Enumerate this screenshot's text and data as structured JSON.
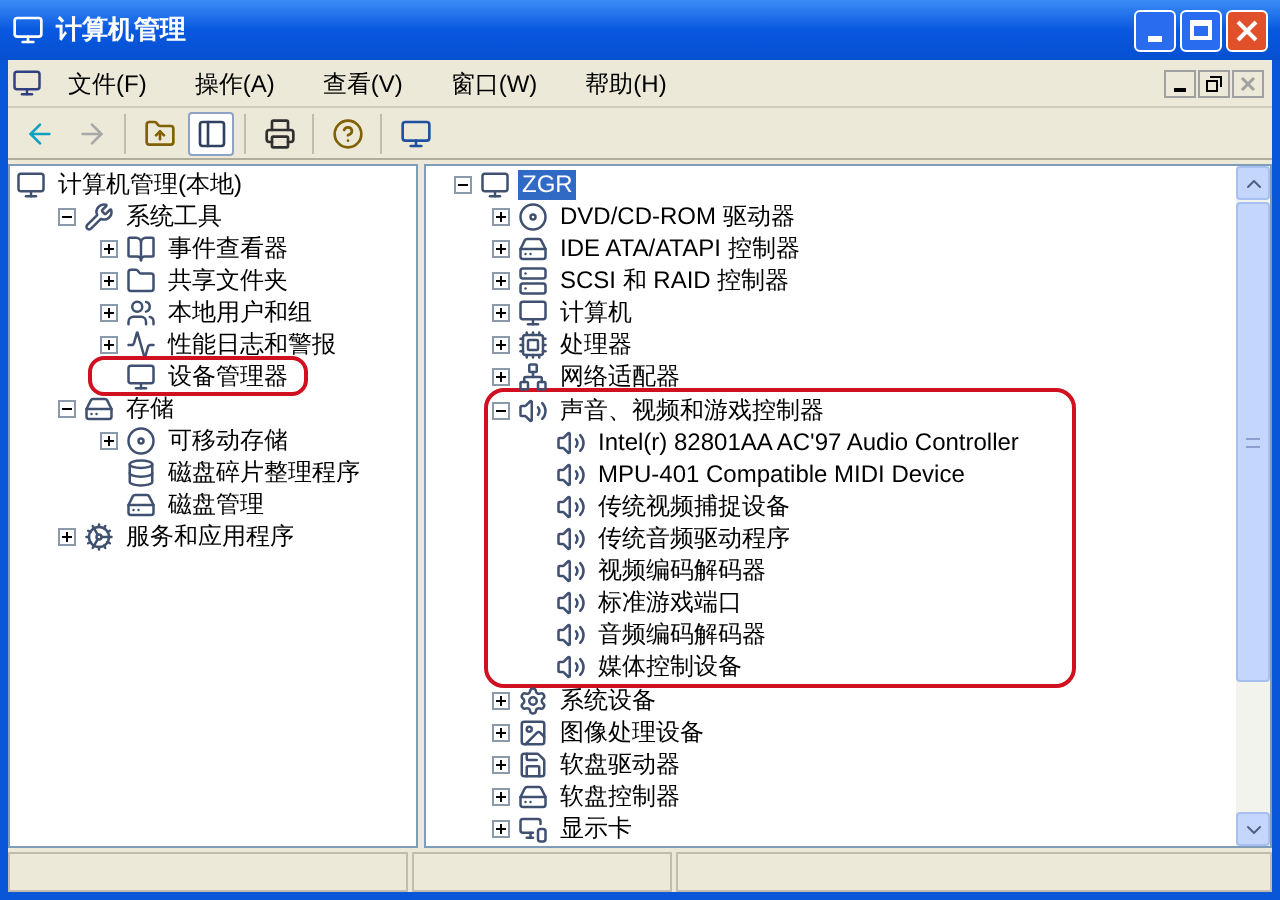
{
  "window": {
    "title": "计算机管理"
  },
  "menu": [
    {
      "label": "文件(F)"
    },
    {
      "label": "操作(A)"
    },
    {
      "label": "查看(V)"
    },
    {
      "label": "窗口(W)"
    },
    {
      "label": "帮助(H)"
    }
  ],
  "child_controls": [
    {
      "disabled": false
    },
    {
      "disabled": false
    },
    {
      "disabled": true
    }
  ],
  "toolbar": [
    {
      "disabled": false,
      "pressed": false
    },
    {
      "disabled": true,
      "pressed": false
    },
    {
      "disabled": false,
      "pressed": false
    },
    {
      "disabled": false,
      "pressed": true
    },
    {
      "disabled": false,
      "pressed": false
    },
    {
      "disabled": false,
      "pressed": false
    },
    {
      "disabled": false,
      "pressed": false
    }
  ],
  "left_tree": [
    {
      "label": "计算机管理(本地)",
      "children": [
        {
          "label": "系统工具",
          "expanded": true,
          "children": [
            {
              "label": "事件查看器",
              "expanded": false
            },
            {
              "label": "共享文件夹",
              "expanded": false
            },
            {
              "label": "本地用户和组",
              "expanded": false
            },
            {
              "label": "性能日志和警报",
              "expanded": false
            },
            {
              "label": "设备管理器",
              "highlighted": true
            }
          ]
        },
        {
          "label": "存储",
          "expanded": true,
          "children": [
            {
              "label": "可移动存储",
              "expanded": false
            },
            {
              "label": "磁盘碎片整理程序"
            },
            {
              "label": "磁盘管理"
            }
          ]
        },
        {
          "label": "服务和应用程序",
          "expanded": false
        }
      ]
    }
  ],
  "right_tree": [
    {
      "label": "ZGR",
      "expanded": true,
      "selected": true,
      "children": [
        {
          "label": "DVD/CD-ROM 驱动器",
          "expanded": false,
          "selected": false
        },
        {
          "label": "IDE ATA/ATAPI 控制器",
          "expanded": false,
          "selected": false
        },
        {
          "label": "SCSI 和 RAID 控制器",
          "expanded": false,
          "selected": false
        },
        {
          "label": "计算机",
          "expanded": false,
          "selected": false
        },
        {
          "label": "处理器",
          "expanded": false,
          "selected": false
        },
        {
          "label": "网络适配器",
          "expanded": false,
          "selected": false
        },
        {
          "label": "声音、视频和游戏控制器",
          "expanded": true,
          "selected": false,
          "highlighted": true,
          "children": [
            {
              "label": "Intel(r) 82801AA AC'97 Audio Controller",
              "selected": false
            },
            {
              "label": "MPU-401 Compatible MIDI Device",
              "selected": false
            },
            {
              "label": "传统视频捕捉设备",
              "selected": false
            },
            {
              "label": "传统音频驱动程序",
              "selected": false
            },
            {
              "label": "视频编码解码器",
              "selected": false
            },
            {
              "label": "标准游戏端口",
              "selected": false
            },
            {
              "label": "音频编码解码器",
              "selected": false
            },
            {
              "label": "媒体控制设备",
              "selected": false
            }
          ]
        },
        {
          "label": "系统设备",
          "expanded": false,
          "selected": false
        },
        {
          "label": "图像处理设备",
          "expanded": false,
          "selected": false
        },
        {
          "label": "软盘驱动器",
          "expanded": false,
          "selected": false
        },
        {
          "label": "软盘控制器",
          "expanded": false,
          "selected": false
        },
        {
          "label": "显示卡",
          "expanded": false,
          "selected": false
        }
      ]
    }
  ]
}
